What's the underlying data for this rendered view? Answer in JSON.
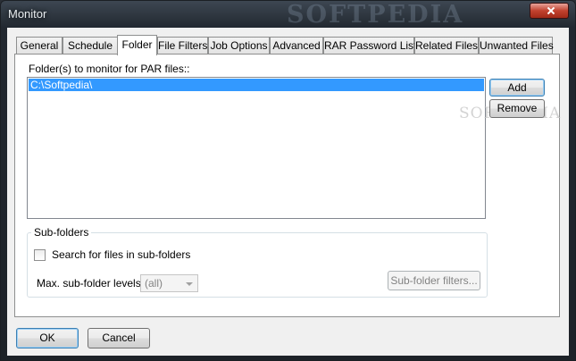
{
  "window": {
    "title": "Monitor",
    "watermark": "SOFTPEDIA"
  },
  "tabs": [
    {
      "label": "General"
    },
    {
      "label": "Schedule"
    },
    {
      "label": "Folder"
    },
    {
      "label": "File Filters"
    },
    {
      "label": "Job Options"
    },
    {
      "label": "Advanced"
    },
    {
      "label": "RAR Password List"
    },
    {
      "label": "Related Files"
    },
    {
      "label": "Unwanted Files"
    }
  ],
  "active_tab": "Folder",
  "folder": {
    "list_label": "Folder(s) to monitor for PAR files::",
    "items": [
      "C:\\Softpedia\\"
    ],
    "add_label": "Add",
    "remove_label": "Remove",
    "list_watermark": "SOFTPEDIA"
  },
  "subfolders": {
    "group_title": "Sub-folders",
    "search_label": "Search for files in sub-folders",
    "search_checked": false,
    "max_levels_label": "Max. sub-folder levels:",
    "max_levels_value": "(all)",
    "filters_label": "Sub-folder filters..."
  },
  "footer": {
    "ok_label": "OK",
    "cancel_label": "Cancel"
  }
}
